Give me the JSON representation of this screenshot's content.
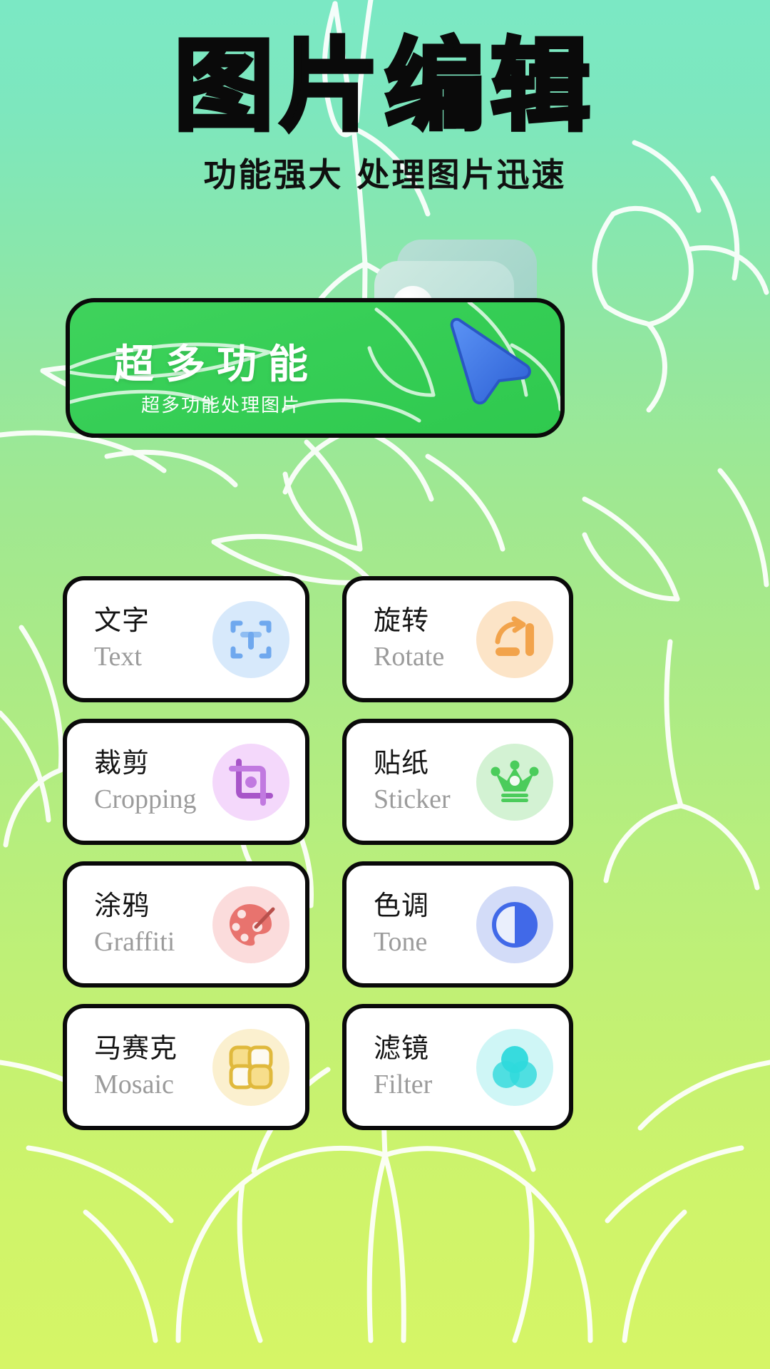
{
  "header": {
    "title": "图片编辑",
    "subtitle": "功能强大 处理图片迅速"
  },
  "banner": {
    "headline": "超多功能",
    "caption": "超多功能处理图片",
    "bg_color": "#35CE55",
    "border_color": "#0A0A0A",
    "text_color": "#FFFFFF",
    "art_icon": "photo-3d-icon",
    "cursor_icon": "mouse-pointer-icon",
    "cursor_color": "#3B78E7"
  },
  "theme": {
    "bg_top": "#7BE8C4",
    "bg_bottom": "#D6F566",
    "card_bg": "#FFFFFF",
    "card_border": "#0A0A0A",
    "label_cn_color": "#141414",
    "label_en_color": "#9B9B9B"
  },
  "features": [
    {
      "cn": "文字",
      "en": "Text",
      "icon": "text-frame-icon",
      "icon_bg": "#D7E9FB",
      "icon_color": "#6FA8EE"
    },
    {
      "cn": "旋转",
      "en": "Rotate",
      "icon": "rotate-arrow-icon",
      "icon_bg": "#FCE4C7",
      "icon_color": "#F2A34B"
    },
    {
      "cn": "裁剪",
      "en": "Cropping",
      "icon": "crop-frame-icon",
      "icon_bg": "#F4D8FB",
      "icon_color": "#B560D6"
    },
    {
      "cn": "贴纸",
      "en": "Sticker",
      "icon": "crown-icon",
      "icon_bg": "#D3F2D3",
      "icon_color": "#4BCC5B"
    },
    {
      "cn": "涂鸦",
      "en": "Graffiti",
      "icon": "palette-brush-icon",
      "icon_bg": "#FBDCDC",
      "icon_color": "#E8736E"
    },
    {
      "cn": "色调",
      "en": "Tone",
      "icon": "contrast-circle-icon",
      "icon_bg": "#D3DCF8",
      "icon_color": "#4169E8"
    },
    {
      "cn": "马赛克",
      "en": "Mosaic",
      "icon": "mosaic-tiles-icon",
      "icon_bg": "#FBF0CF",
      "icon_color": "#EFC84A"
    },
    {
      "cn": "滤镜",
      "en": "Filter",
      "icon": "filter-circles-icon",
      "icon_bg": "#CFF6F6",
      "icon_color": "#2ED9DC"
    }
  ]
}
